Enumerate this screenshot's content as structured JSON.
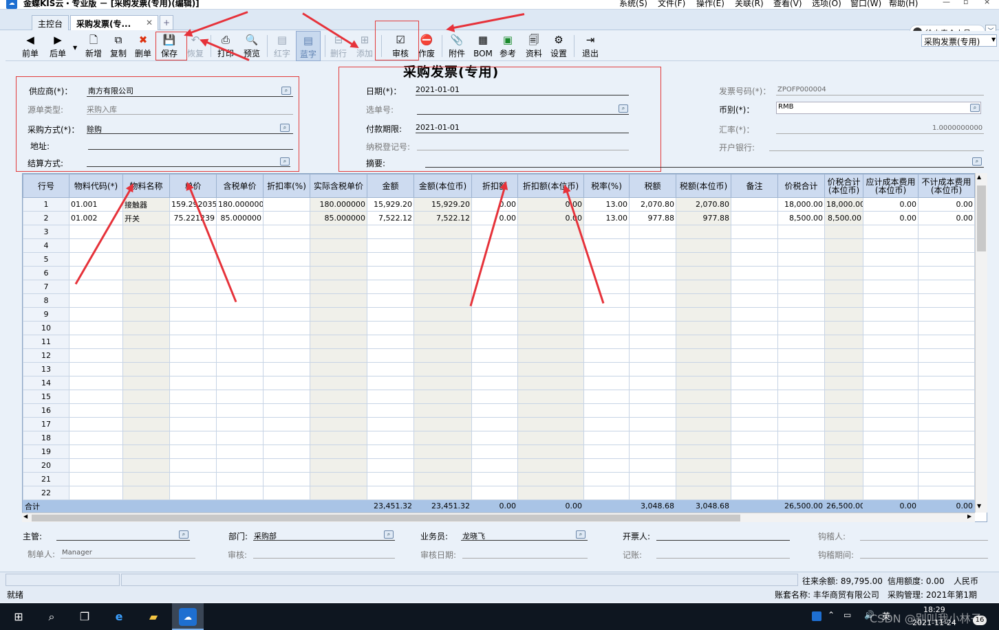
{
  "window": {
    "title": "金蝶KIS云・专业版 － [采购发票(专用)(编辑)]",
    "menus": [
      "系统(S)",
      "文件(F)",
      "操作(E)",
      "关联(R)",
      "查看(V)",
      "选项(O)",
      "窗口(W)",
      "帮助(H)"
    ],
    "controls": [
      "—",
      "▫",
      "×"
    ]
  },
  "tabs": [
    {
      "label": "主控台"
    },
    {
      "label": "采购发票(专..."
    }
  ],
  "user": {
    "name": "徐少春个人号"
  },
  "toolbar": {
    "items": [
      "前单",
      "后单",
      "新增",
      "复制",
      "删单",
      "保存",
      "恢复",
      "打印",
      "预览",
      "红字",
      "蓝字",
      "删行",
      "添加",
      "审核",
      "作废",
      "附件",
      "BOM",
      "参考",
      "资料",
      "设置",
      "退出"
    ],
    "form_type": "采购发票(专用)"
  },
  "form": {
    "title": "采购发票(专用)",
    "left": {
      "supplier_label": "供应商(*)：",
      "supplier": "南方有限公司",
      "source_label": "源单类型:",
      "source": "采购入库",
      "method_label": "采购方式(*)：",
      "method": "赊购",
      "address_label": "地址:",
      "settle_label": "结算方式:"
    },
    "mid": {
      "date_label": "日期(*)：",
      "date": "2021-01-01",
      "select_label": "选单号:",
      "due_label": "付款期限:",
      "due": "2021-01-01",
      "tax_label": "纳税登记号:",
      "summary_label": "摘要:"
    },
    "right": {
      "invoice_label": "发票号码(*)：",
      "invoice": "ZPOFP000004",
      "currency_label": "币别(*)：",
      "currency": "RMB",
      "rate_label": "汇率(*)：",
      "rate": "1.0000000000",
      "bank_label": "开户银行:"
    }
  },
  "grid": {
    "headers": [
      "行号",
      "物料代码(*)",
      "物料名称",
      "单价",
      "含税单价",
      "折扣率(%)",
      "实际含税单价",
      "金额",
      "金额(本位币)",
      "折扣额",
      "折扣额(本位币)",
      "税率(%)",
      "税额",
      "税额(本位币)",
      "备注",
      "价税合计",
      "价税合计(本位币)",
      "应计成本费用(本位币)",
      "不计成本费用(本位币)"
    ],
    "rows": [
      [
        "1",
        "01.001",
        "接触器",
        "159.292035",
        "180.000000",
        "",
        "180.000000",
        "15,929.20",
        "15,929.20",
        "0.00",
        "0.00",
        "13.00",
        "2,070.80",
        "2,070.80",
        "",
        "18,000.00",
        "18,000.00",
        "0.00",
        "0.00"
      ],
      [
        "2",
        "01.002",
        "开关",
        "75.221239",
        "85.000000",
        "",
        "85.000000",
        "7,522.12",
        "7,522.12",
        "0.00",
        "0.00",
        "13.00",
        "977.88",
        "977.88",
        "",
        "8,500.00",
        "8,500.00",
        "0.00",
        "0.00"
      ]
    ],
    "empty_rows": [
      "3",
      "4",
      "5",
      "6",
      "7",
      "8",
      "9",
      "10",
      "11",
      "12",
      "13",
      "14",
      "15",
      "16",
      "17",
      "18",
      "19",
      "20",
      "21",
      "22"
    ],
    "total": [
      "合计",
      "",
      "",
      "",
      "",
      "",
      "",
      "23,451.32",
      "23,451.32",
      "0.00",
      "0.00",
      "",
      "3,048.68",
      "3,048.68",
      "",
      "26,500.00",
      "26,500.00",
      "0.00",
      "0.00"
    ]
  },
  "footer": {
    "manager_label": "主管:",
    "dept_label": "部门:",
    "dept": "采购部",
    "salesman_label": "业务员:",
    "salesman": "龙晓飞",
    "issuer_label": "开票人:",
    "checker_label": "钩稽人:",
    "maker_label": "制单人:",
    "maker": "Manager",
    "audit_label": "审核:",
    "audit_date_label": "审核日期:",
    "record_label": "记账:",
    "check_date_label": "钩稽期间:"
  },
  "status": {
    "balance": "往来余额: 89,795.00",
    "credit": "信用额度: 0.00",
    "currency": "人民币",
    "ready": "就绪",
    "account": "账套名称: 丰华商贸有限公司",
    "period": "采购管理: 2021年第1期"
  },
  "taskbar": {
    "time": "18:29",
    "date": "2021-11-24",
    "lang": "英",
    "watermark": "CSDN @别叫我小林子",
    "badge": "16"
  },
  "colors": {
    "annotation": "#e6323a",
    "grid_header": "#cddbf0",
    "total_row": "#a9c4e6"
  }
}
